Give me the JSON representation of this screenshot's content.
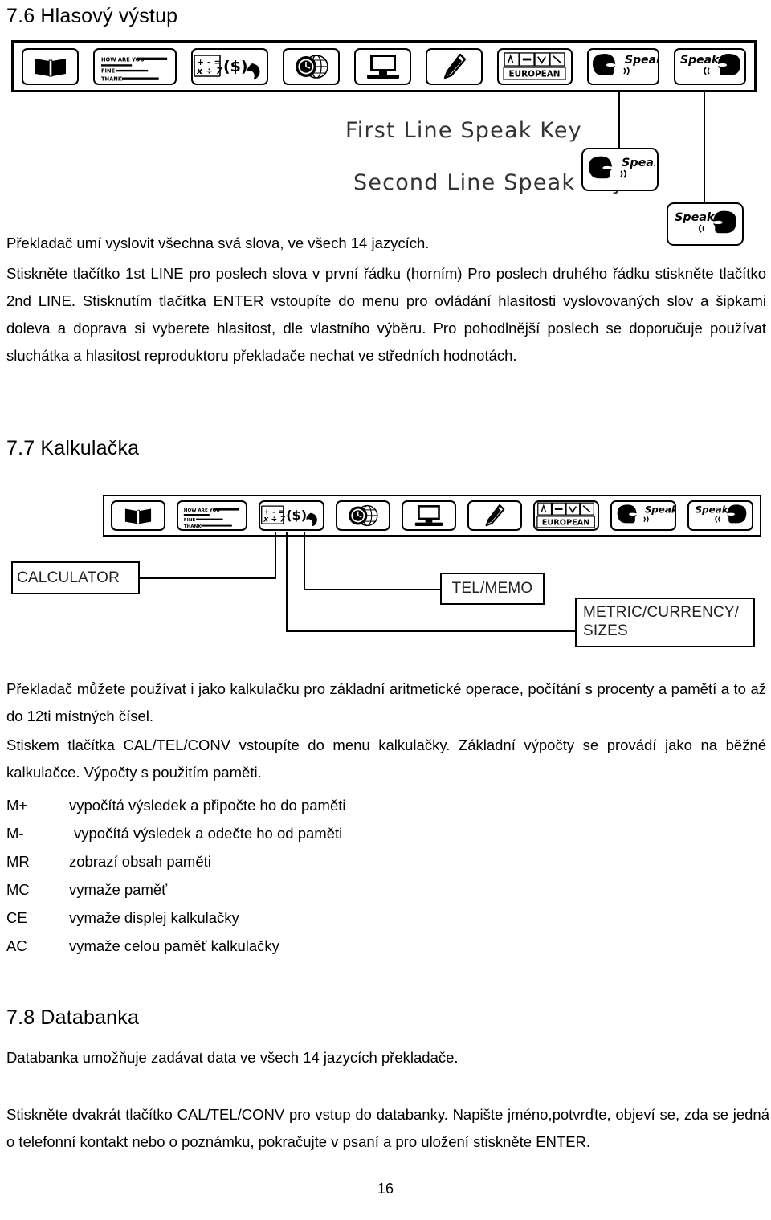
{
  "document": {
    "page_number": "16"
  },
  "sections": {
    "voice_output": {
      "number": "7.6",
      "title": "Hlasový výstup",
      "diagram": {
        "label_first_line": "First Line Speak Key",
        "label_second_line": "Second Line Speak Key",
        "speak_text": "Speak",
        "european_text": "EUROPEAN",
        "memo_lines": [
          "HOW ARE YOU",
          "FINE",
          "THANK"
        ],
        "calc_keys": "+ - =  x ÷ 7",
        "currency_text": "($)"
      },
      "paragraphs": [
        "Překladač umí vyslovit všechna svá slova, ve všech 14 jazycích.",
        "Stiskněte tlačítko 1st LINE pro poslech slova v první řádku (horním) Pro poslech druhého řádku stiskněte tlačítko 2nd LINE.  Stisknutím tlačítka ENTER vstoupíte do menu pro ovládání hlasitosti vyslovovaných slov a šipkami doleva a doprava si vyberete hlasitost, dle vlastního výběru. Pro pohodlnější poslech se doporučuje používat sluchátka a hlasitost reproduktoru překladače nechat ve středních hodnotách."
      ]
    },
    "calculator": {
      "number": "7.7",
      "title": "Kalkulačka",
      "diagram": {
        "label_calculator": "CALCULATOR",
        "label_tel_memo": "TEL/MEMO",
        "label_metric": "METRIC/CURRENCY/ SIZES",
        "label_metric_line1": "METRIC/CURRENCY/",
        "label_metric_line2": "SIZES",
        "speak_text": "Speak",
        "european_text": "EUROPEAN"
      },
      "paragraphs": [
        "Překladač můžete používat i jako kalkulačku pro základní aritmetické operace, počítání s procenty a pamětí a to až do 12ti místných čísel.",
        "Stiskem tlačítka CAL/TEL/CONV vstoupíte do menu kalkulačky. Základní výpočty se provádí jako na běžné kalkulačce. Výpočty s použitím paměti."
      ],
      "memory_functions": [
        {
          "code": "M+",
          "desc": "vypočítá výsledek a připočte ho do paměti"
        },
        {
          "code": "M-",
          "desc": "vypočítá výsledek a odečte ho od paměti"
        },
        {
          "code": "MR",
          "desc": "zobrazí obsah paměti"
        },
        {
          "code": "MC",
          "desc": "vymaže paměť"
        },
        {
          "code": "CE",
          "desc": "vymaže displej kalkulačky"
        },
        {
          "code": "AC",
          "desc": "vymaže celou paměť kalkulačky"
        }
      ]
    },
    "databank": {
      "number": "7.8",
      "title": "Databanka",
      "paragraphs": [
        "Databanka umožňuje zadávat data ve všech 14 jazycích překladače.",
        "Stiskněte dvakrát tlačítko CAL/TEL/CONV pro vstup do databanky. Napište jméno,potvrďte,  objeví se, zda se jedná o telefonní kontakt nebo o poznámku, pokračujte v psaní a pro uložení stiskněte ENTER."
      ]
    }
  },
  "colors": {
    "ink": "#000000",
    "paper": "#ffffff",
    "diagram_label": "#222222"
  }
}
